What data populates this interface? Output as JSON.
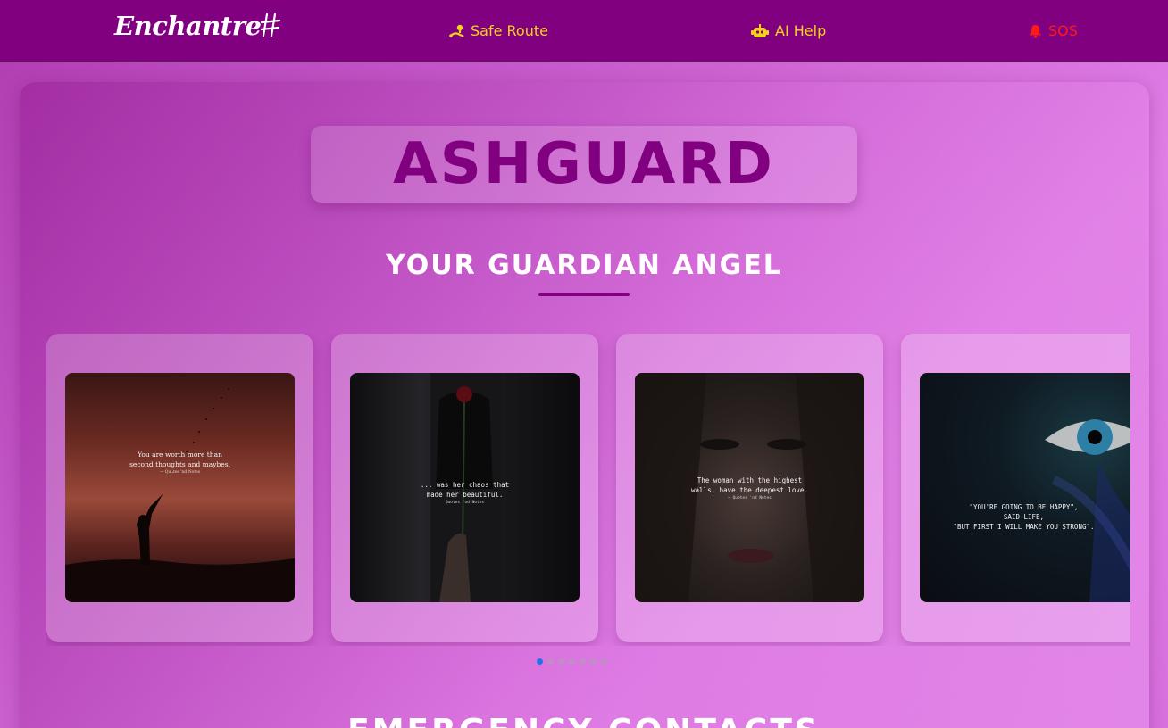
{
  "navbar": {
    "brand": "Enchantre",
    "links": [
      {
        "label": "Safe Route",
        "icon": "route-icon",
        "color": "#f2d21b"
      },
      {
        "label": "AI Help",
        "icon": "robot-icon",
        "color": "#f2d21b"
      },
      {
        "label": "SOS",
        "icon": "bell-icon",
        "color": "#ff1a1a"
      }
    ]
  },
  "hero": {
    "logo": "ASHGUARD",
    "tagline": "YOUR GUARDIAN ANGEL"
  },
  "carousel": {
    "cards": [
      {
        "quote": [
          "You are worth more than",
          "second thoughts and maybes."
        ],
        "source": "— Quotes 'nd Notes"
      },
      {
        "quote": [
          "... was her chaos that",
          "made her beautiful."
        ],
        "source": "Quotes 'nd Notes"
      },
      {
        "quote": [
          "The woman with the highest",
          "walls, have the deepest love."
        ],
        "source": "— Quotes 'nd Notes"
      },
      {
        "quote": [
          "\"YOU'RE GOING TO BE HAPPY\",",
          "SAID LIFE,",
          "\"BUT FIRST I WILL MAKE YOU STRONG\"."
        ],
        "source": ""
      }
    ],
    "dot_count": 7,
    "active_index": 0
  },
  "sections": {
    "emergency_title": "EMERGENCY CONTACTS"
  },
  "colors": {
    "navbar": "#800080",
    "accent": "#800080",
    "link": "#f2d21b",
    "sos": "#ff1a1a",
    "active_dot": "#1e73e8"
  }
}
